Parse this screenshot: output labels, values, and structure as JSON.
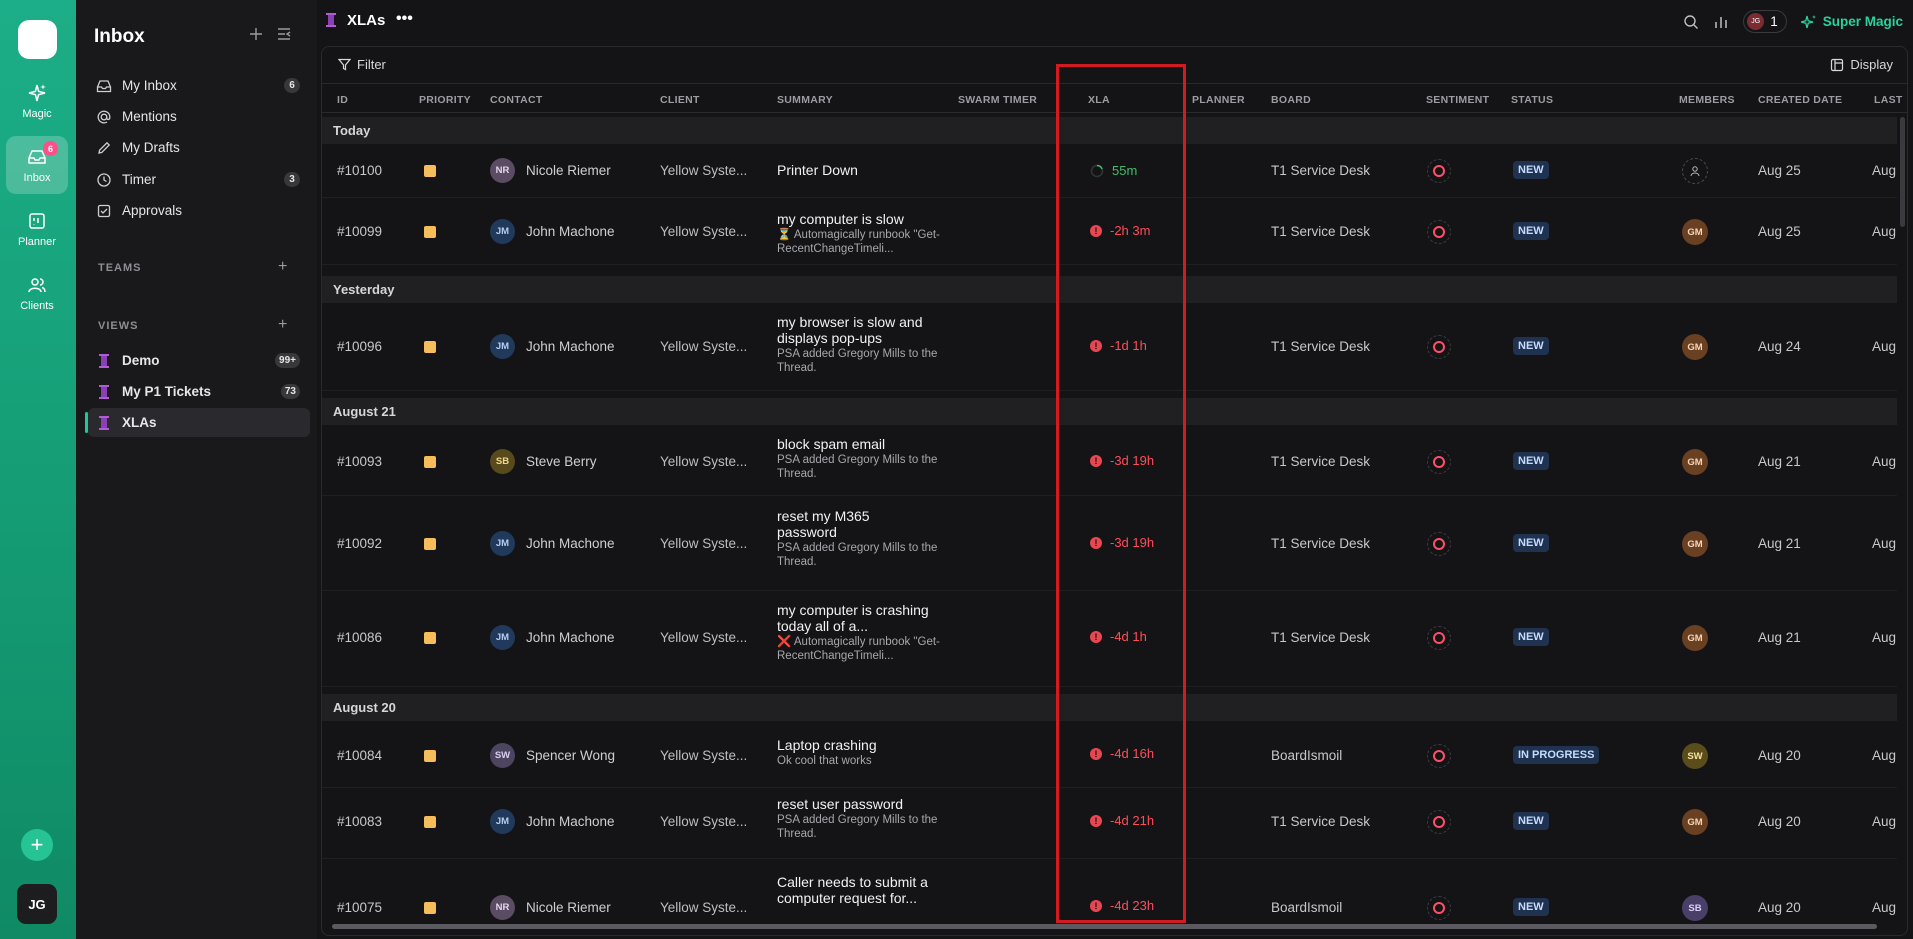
{
  "rail": {
    "items": [
      {
        "label": "Magic"
      },
      {
        "label": "Inbox",
        "badge": "6"
      },
      {
        "label": "Planner"
      },
      {
        "label": "Clients"
      }
    ],
    "avatar": "JG",
    "add": "+"
  },
  "sidebar": {
    "title": "Inbox",
    "nav": [
      {
        "label": "My Inbox",
        "count": "6"
      },
      {
        "label": "Mentions"
      },
      {
        "label": "My Drafts"
      },
      {
        "label": "Timer",
        "count": "3"
      },
      {
        "label": "Approvals"
      }
    ],
    "teams_label": "TEAMS",
    "views_label": "VIEWS",
    "views": [
      {
        "label": "Demo",
        "count": "99+"
      },
      {
        "label": "My P1 Tickets",
        "count": "73"
      },
      {
        "label": "XLAs"
      }
    ]
  },
  "topbar": {
    "title": "XLAs",
    "more": "•••",
    "notif_avatar": "JG",
    "notif_count": "1",
    "super_magic": "Super Magic"
  },
  "filterbar": {
    "filter": "Filter",
    "display": "Display"
  },
  "columns": [
    "ID",
    "PRIORITY",
    "CONTACT",
    "CLIENT",
    "SUMMARY",
    "SWARM TIMER",
    "XLA",
    "PLANNER",
    "BOARD",
    "SENTIMENT",
    "STATUS",
    "MEMBERS",
    "CREATED DATE",
    "LAST"
  ],
  "groups": [
    "Today",
    "Yesterday",
    "August 21",
    "August 20"
  ],
  "rows": [
    {
      "id": "#10100",
      "contact_initials": "NR",
      "contact": "Nicole Riemer",
      "client": "Yellow Syste...",
      "summary": "Printer Down",
      "sub": "",
      "xla": "55m",
      "board": "T1 Service Desk",
      "status": "NEW",
      "member": "",
      "created": "Aug 25",
      "last": "Aug"
    },
    {
      "id": "#10099",
      "contact_initials": "JM",
      "contact": "John Machone",
      "client": "Yellow Syste...",
      "summary": "my computer is slow",
      "sub": "⏳ Automagically runbook \"Get-RecentChangeTimeli...",
      "xla": "-2h 3m",
      "board": "T1 Service Desk",
      "status": "NEW",
      "member": "GM",
      "created": "Aug 25",
      "last": "Aug"
    },
    {
      "id": "#10096",
      "contact_initials": "JM",
      "contact": "John Machone",
      "client": "Yellow Syste...",
      "summary": "my browser is slow and displays pop-ups",
      "sub": "PSA added Gregory Mills to the Thread.",
      "xla": "-1d 1h",
      "board": "T1 Service Desk",
      "status": "NEW",
      "member": "GM",
      "created": "Aug 24",
      "last": "Aug"
    },
    {
      "id": "#10093",
      "contact_initials": "SB",
      "contact": "Steve Berry",
      "client": "Yellow Syste...",
      "summary": "block spam email",
      "sub": "PSA added Gregory Mills to the Thread.",
      "xla": "-3d 19h",
      "board": "T1 Service Desk",
      "status": "NEW",
      "member": "GM",
      "created": "Aug 21",
      "last": "Aug"
    },
    {
      "id": "#10092",
      "contact_initials": "JM",
      "contact": "John Machone",
      "client": "Yellow Syste...",
      "summary": "reset my M365 password",
      "sub": "PSA added Gregory Mills to the Thread.",
      "xla": "-3d 19h",
      "board": "T1 Service Desk",
      "status": "NEW",
      "member": "GM",
      "created": "Aug 21",
      "last": "Aug"
    },
    {
      "id": "#10086",
      "contact_initials": "JM",
      "contact": "John Machone",
      "client": "Yellow Syste...",
      "summary": "my computer is crashing today all of a...",
      "sub": "❌ Automagically runbook \"Get-RecentChangeTimeli...",
      "xla": "-4d 1h",
      "board": "T1 Service Desk",
      "status": "NEW",
      "member": "GM",
      "created": "Aug 21",
      "last": "Aug"
    },
    {
      "id": "#10084",
      "contact_initials": "SW",
      "contact": "Spencer Wong",
      "client": "Yellow Syste...",
      "summary": "Laptop crashing",
      "sub": "Ok cool that works",
      "xla": "-4d 16h",
      "board": "BoardIsmoil",
      "status": "IN PROGRESS",
      "member": "SW",
      "created": "Aug 20",
      "last": "Aug"
    },
    {
      "id": "#10083",
      "contact_initials": "JM",
      "contact": "John Machone",
      "client": "Yellow Syste...",
      "summary": "reset user password",
      "sub": "PSA added Gregory Mills to the Thread.",
      "xla": "-4d 21h",
      "board": "T1 Service Desk",
      "status": "NEW",
      "member": "GM",
      "created": "Aug 20",
      "last": "Aug"
    },
    {
      "id": "#10075",
      "contact_initials": "NR",
      "contact": "Nicole Riemer",
      "client": "Yellow Syste...",
      "summary": "Caller needs to submit a computer request for...",
      "sub": "",
      "xla": "-4d 23h",
      "board": "BoardIsmoil",
      "status": "NEW",
      "member": "SB",
      "created": "Aug 20",
      "last": "Aug"
    }
  ],
  "colors": {
    "accent": "#1fc896",
    "negative": "#ff4d5a",
    "positive": "#3fbf6f",
    "priority": "#f6be5b"
  }
}
